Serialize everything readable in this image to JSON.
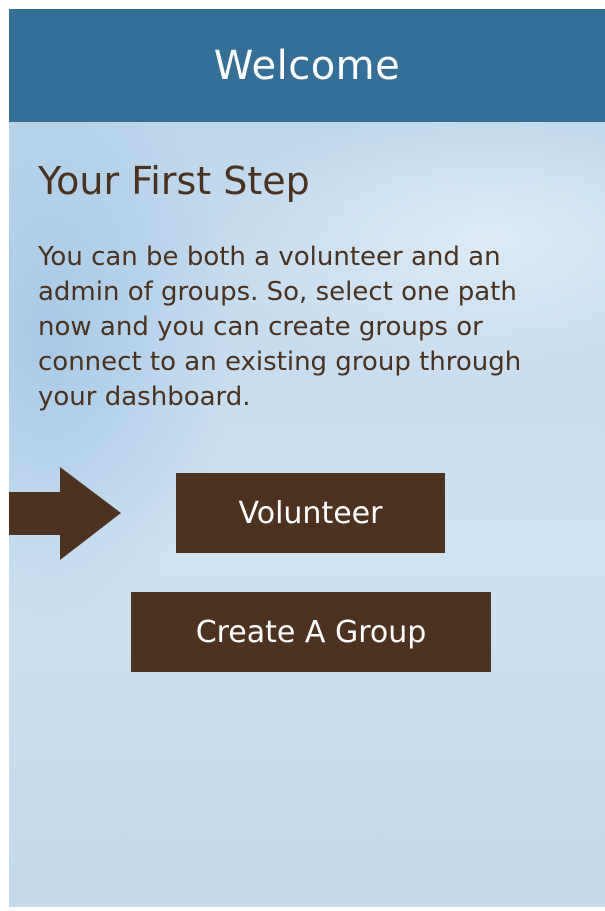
{
  "header": {
    "title": "Welcome"
  },
  "main": {
    "step_title": "Your First Step",
    "intro": "You can be both a volunteer and an admin of groups. So, select one path now and you can create groups or connect to an existing group through your dashboard.",
    "volunteer_label": "Volunteer",
    "create_group_label": "Create A Group"
  },
  "icons": {
    "pointer": "arrow-right-icon"
  },
  "colors": {
    "header_bg": "#356e96",
    "accent_brown": "#4e3220",
    "text_brown": "#4a3220"
  }
}
